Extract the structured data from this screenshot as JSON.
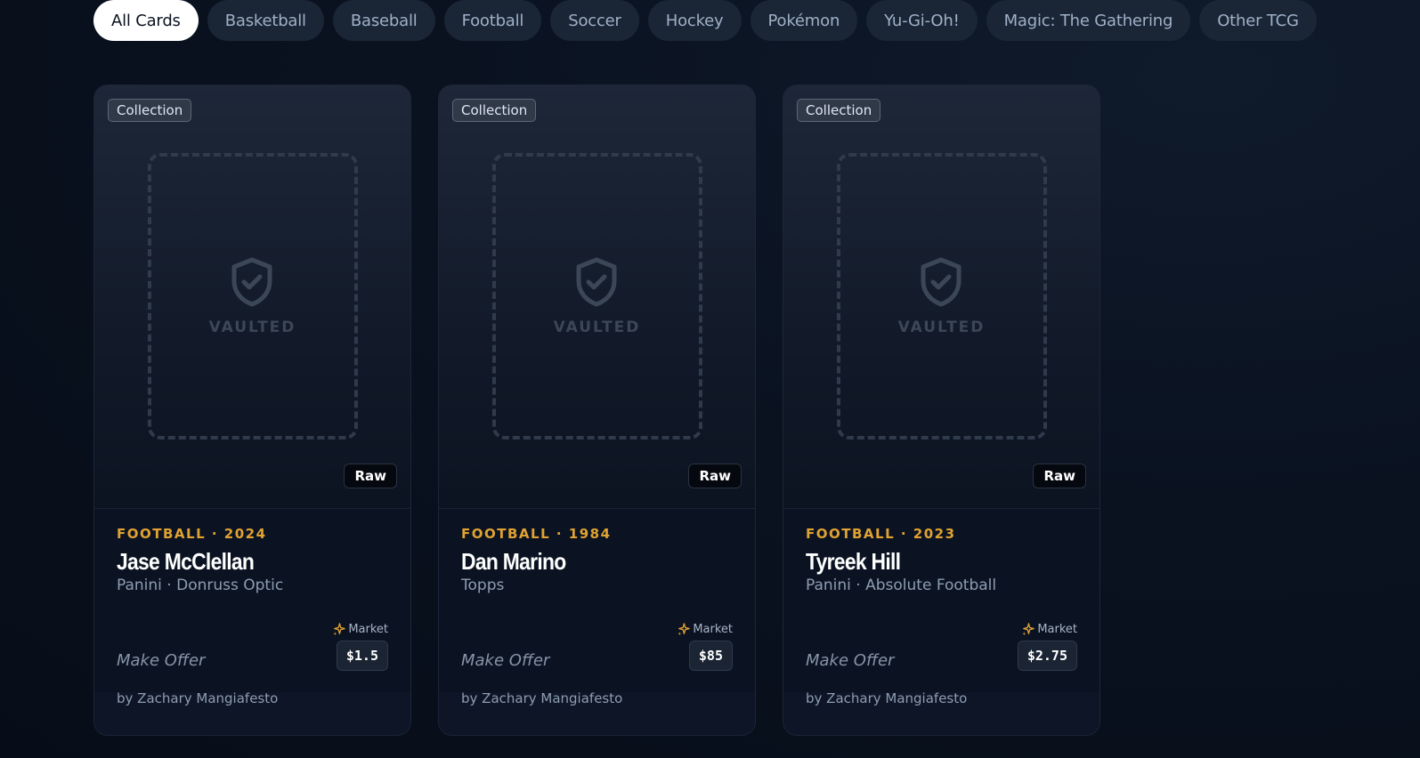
{
  "filters": [
    {
      "label": "All Cards",
      "active": true
    },
    {
      "label": "Basketball",
      "active": false
    },
    {
      "label": "Baseball",
      "active": false
    },
    {
      "label": "Football",
      "active": false
    },
    {
      "label": "Soccer",
      "active": false
    },
    {
      "label": "Hockey",
      "active": false
    },
    {
      "label": "Pokémon",
      "active": false
    },
    {
      "label": "Yu-Gi-Oh!",
      "active": false
    },
    {
      "label": "Magic: The Gathering",
      "active": false
    },
    {
      "label": "Other TCG",
      "active": false
    }
  ],
  "cards": [
    {
      "badge": "Collection",
      "vault_label": "VAULTED",
      "condition": "Raw",
      "meta": "FOOTBALL · 2024",
      "name": "Jase McClellan",
      "set": "Panini · Donruss Optic",
      "market_label": "Market",
      "price": "$1.5",
      "offer_label": "Make Offer",
      "seller": "by Zachary Mangiafesto"
    },
    {
      "badge": "Collection",
      "vault_label": "VAULTED",
      "condition": "Raw",
      "meta": "FOOTBALL · 1984",
      "name": "Dan Marino",
      "set": "Topps",
      "market_label": "Market",
      "price": "$85",
      "offer_label": "Make Offer",
      "seller": "by Zachary Mangiafesto"
    },
    {
      "badge": "Collection",
      "vault_label": "VAULTED",
      "condition": "Raw",
      "meta": "FOOTBALL · 2023",
      "name": "Tyreek Hill",
      "set": "Panini · Absolute Football",
      "market_label": "Market",
      "price": "$2.75",
      "offer_label": "Make Offer",
      "seller": "by Zachary Mangiafesto"
    }
  ],
  "icons": {
    "vault": "shield-check-icon",
    "market": "sparkle-icon"
  },
  "colors": {
    "accent": "#e0a232",
    "background": "#0a1220",
    "chip": "#1a2536",
    "chip_active": "#ffffff"
  }
}
